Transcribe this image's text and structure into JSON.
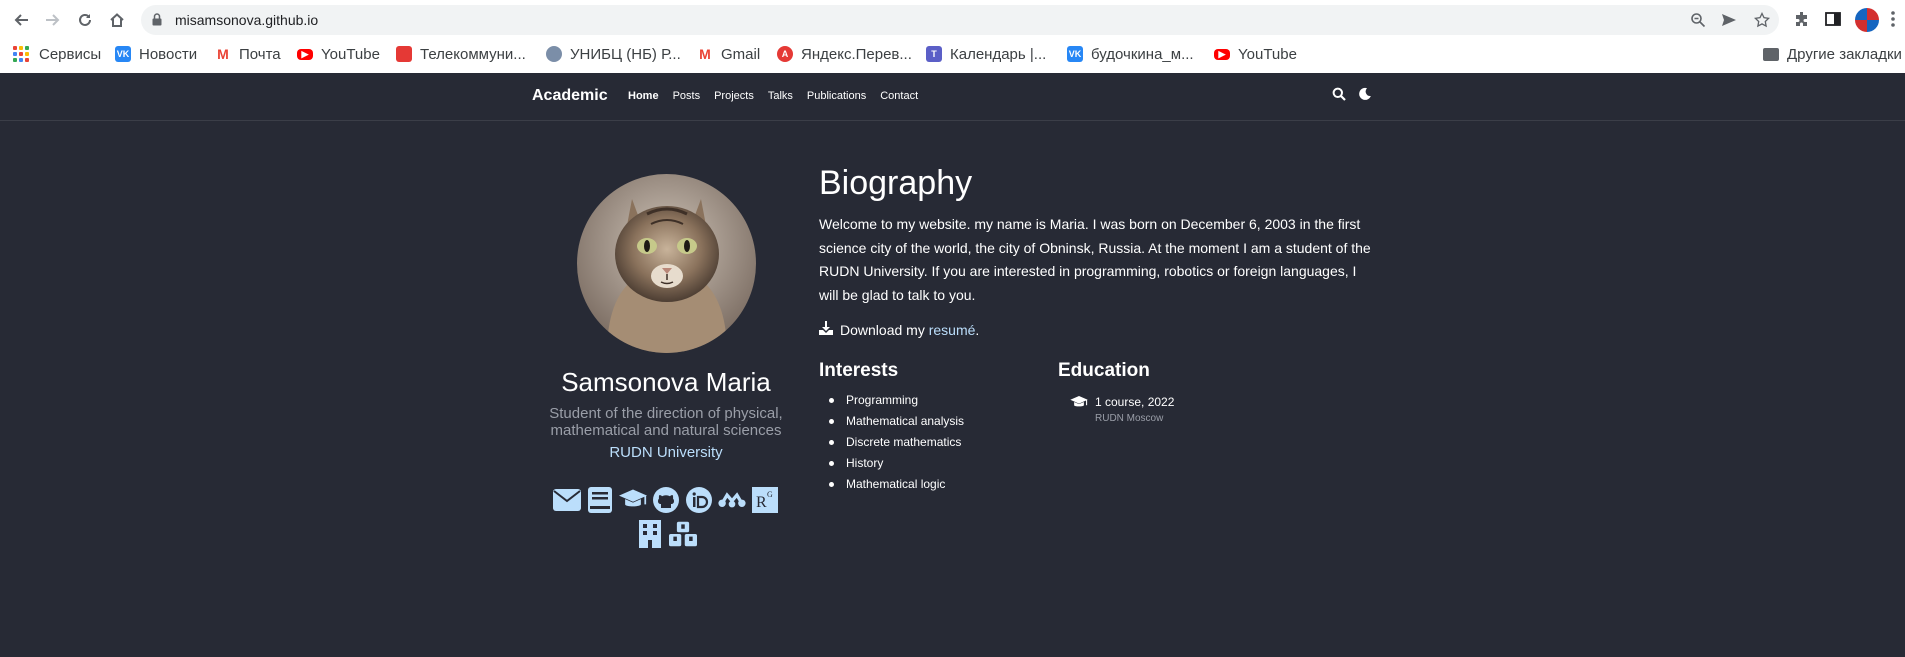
{
  "browser": {
    "url": "misamsonova.github.io",
    "bookmarks": [
      {
        "label": "Сервисы",
        "icon": "apps-grid-icon"
      },
      {
        "label": "Новости",
        "icon": "vk-icon"
      },
      {
        "label": "Почта",
        "icon": "mail-icon"
      },
      {
        "label": "YouTube",
        "icon": "youtube-icon"
      },
      {
        "label": "Телекоммуни...",
        "icon": "bookmark-icon"
      },
      {
        "label": "УНИБЦ (НБ) Р...",
        "icon": "library-icon"
      },
      {
        "label": "Gmail",
        "icon": "gmail-icon"
      },
      {
        "label": "Яндекс.Перев...",
        "icon": "yandex-translate-icon"
      },
      {
        "label": "Календарь |...",
        "icon": "teams-icon"
      },
      {
        "label": "будочкина_м...",
        "icon": "vk-icon"
      },
      {
        "label": "YouTube",
        "icon": "youtube-icon"
      }
    ],
    "other_bookmarks": "Другие закладки"
  },
  "site": {
    "brand": "Academic",
    "menu": [
      "Home",
      "Posts",
      "Projects",
      "Talks",
      "Publications",
      "Contact"
    ],
    "active_menu": "Home",
    "accent_color": "#bbdefb",
    "background_color": "#272a35"
  },
  "profile": {
    "name": "Samsonova Maria",
    "role": "Student of the direction of physical, mathematical and natural sciences",
    "organization": "RUDN University",
    "social_icons": [
      "envelope-icon",
      "book-icon",
      "graduation-cap-icon",
      "github-icon",
      "orcid-icon",
      "mendeley-icon",
      "researchgate-icon",
      "building-icon",
      "cubes-icon"
    ]
  },
  "biography": {
    "title": "Biography",
    "text": "Welcome to my website. my name is Maria. I was born on December 6, 2003 in the first science city of the world, the city of Obninsk, Russia. At the moment I am a student of the RUDN University. If you are interested in programming, robotics or foreign languages, I will be glad to talk to you.",
    "download_prefix": "Download my ",
    "download_link": "resumé",
    "download_suffix": "."
  },
  "interests": {
    "title": "Interests",
    "items": [
      "Programming",
      "Mathematical analysis",
      "Discrete mathematics",
      "History",
      "Mathematical logic"
    ]
  },
  "education": {
    "title": "Education",
    "items": [
      {
        "course": "1 course, 2022",
        "institution": "RUDN Moscow"
      }
    ]
  }
}
